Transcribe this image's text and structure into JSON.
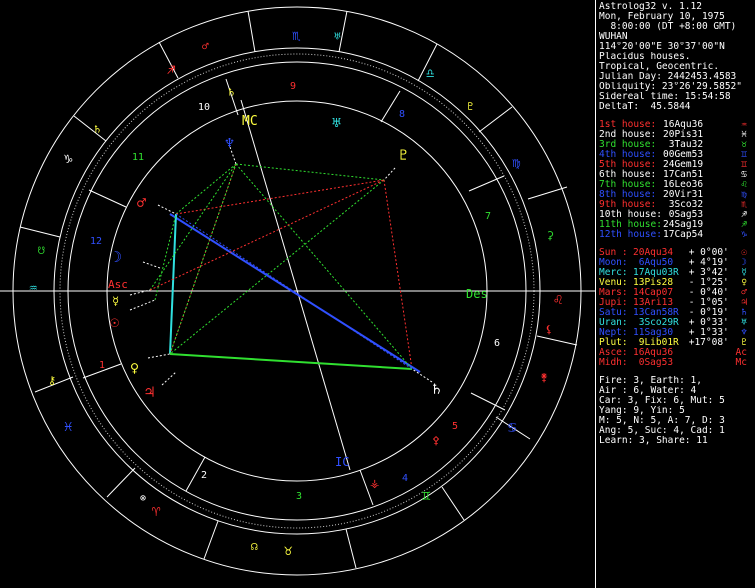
{
  "info": {
    "title": "Astrolog32 v. 1.12",
    "date": "Mon, February 10, 1975",
    "time": "  8:00:00 (DT +8:00 GMT)",
    "place": "WUHAN",
    "coords": "114°20'00\"E 30°37'00\"N",
    "system": "Placidus houses.",
    "zodiac": "Tropical, Geocentric.",
    "julian": "Julian Day: 2442453.4583",
    "obliquity": "Obliquity: 23°26'29.5852\"",
    "sidereal": "Sidereal time: 15:54:58",
    "delta": "DeltaT:  45.5844"
  },
  "houses": [
    {
      "label": "1st house:",
      "value": "16Aqu36",
      "glyph": "♒",
      "color": "#ff3030"
    },
    {
      "label": "2nd house:",
      "value": "20Pis31",
      "glyph": "♓",
      "color": "#ffffff"
    },
    {
      "label": "3rd house:",
      "value": " 3Tau32",
      "glyph": "♉",
      "color": "#30e030"
    },
    {
      "label": "4th house:",
      "value": "00Gem53",
      "glyph": "♊",
      "color": "#3050ff"
    },
    {
      "label": "5th house:",
      "value": "24Gem19",
      "glyph": "♊",
      "color": "#ff3030"
    },
    {
      "label": "6th house:",
      "value": "17Can51",
      "glyph": "♋",
      "color": "#ffffff"
    },
    {
      "label": "7th house:",
      "value": "16Leo36",
      "glyph": "♌",
      "color": "#30e030"
    },
    {
      "label": "8th house:",
      "value": "20Vir31",
      "glyph": "♍",
      "color": "#3050ff"
    },
    {
      "label": "9th house:",
      "value": " 3Sco32",
      "glyph": "♏",
      "color": "#ff3030"
    },
    {
      "label": "10th house:",
      "value": " 0Sag53",
      "glyph": "♐",
      "color": "#ffffff"
    },
    {
      "label": "11th house:",
      "value": "24Sag19",
      "glyph": "♐",
      "color": "#30e030"
    },
    {
      "label": "12th house:",
      "value": "17Cap54",
      "glyph": "♑",
      "color": "#3050ff"
    }
  ],
  "planets": [
    {
      "label": "Sun :",
      "pos": "20Aqu34",
      "lat": " + 0°00'",
      "glyph": "☉",
      "color": "#ff3030"
    },
    {
      "label": "Moon:",
      "pos": " 6Aqu50",
      "lat": " + 4°19'",
      "glyph": "☽",
      "color": "#3050ff"
    },
    {
      "label": "Merc:",
      "pos": "17Aqu03R",
      "lat": " + 3°42'",
      "glyph": "☿",
      "color": "#30e0e0"
    },
    {
      "label": "Venu:",
      "pos": "13Pis28",
      "lat": " - 1°25'",
      "glyph": "♀",
      "color": "#ffff40"
    },
    {
      "label": "Mars:",
      "pos": "14Cap07",
      "lat": " - 0°40'",
      "glyph": "♂",
      "color": "#ff3030"
    },
    {
      "label": "Jupi:",
      "pos": "13Ari13",
      "lat": " - 1°05'",
      "glyph": "♃",
      "color": "#ff3030"
    },
    {
      "label": "Satu:",
      "pos": "13Can58R",
      "lat": " - 0°19'",
      "glyph": "♄",
      "color": "#3050ff"
    },
    {
      "label": "Uran:",
      "pos": " 3Sco29R",
      "lat": " + 0°33'",
      "glyph": "♅",
      "color": "#30e0e0"
    },
    {
      "label": "Nept:",
      "pos": "11Sag30",
      "lat": " + 1°33'",
      "glyph": "♆",
      "color": "#3050ff"
    },
    {
      "label": "Plut:",
      "pos": " 9Lib01R",
      "lat": " +17°08'",
      "glyph": "♇",
      "color": "#ffff40"
    },
    {
      "label": "Asce:",
      "pos": "16Aqu36",
      "lat": "",
      "glyph": "Ac",
      "color": "#ff3030"
    },
    {
      "label": "Midh:",
      "pos": " 0Sag53",
      "lat": "",
      "glyph": "Mc",
      "color": "#ff3030"
    }
  ],
  "stats": [
    "Fire: 3, Earth: 1,",
    "Air : 6, Water: 4",
    "Car: 3, Fix: 6, Mut: 5",
    "Yang: 9, Yin: 5",
    "M: 5, N: 5, A: 7, D: 3",
    "Ang: 5, Suc: 4, Cad: 1",
    "Learn: 3, Share: 11"
  ],
  "chart": {
    "angle_labels": {
      "asc": "Asc",
      "des": "Des",
      "mc": "MC",
      "ic": "IC"
    },
    "house_numbers": [
      "1",
      "2",
      "3",
      "4",
      "5",
      "6",
      "7",
      "8",
      "9",
      "10",
      "11",
      "12"
    ]
  },
  "colors": {
    "red": "#ff3030",
    "green": "#30e030",
    "blue": "#3050ff",
    "cyan": "#30e0e0",
    "yellow": "#ffff40",
    "white": "#ffffff"
  }
}
